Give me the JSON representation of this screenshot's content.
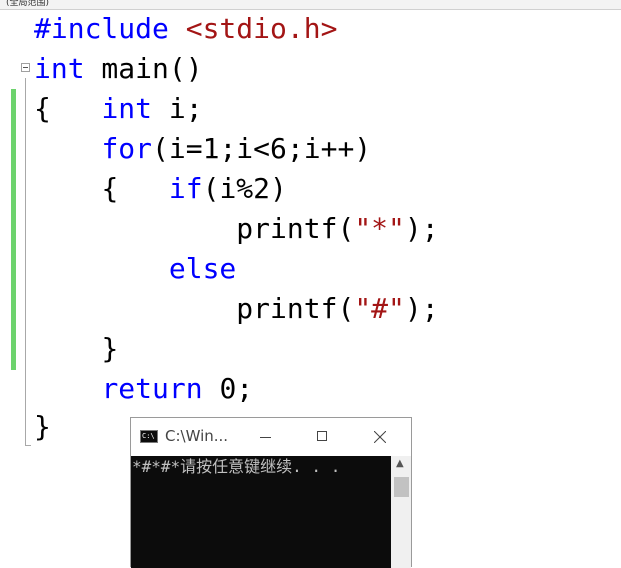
{
  "top_strip": {
    "text": "(全局范围)"
  },
  "code": {
    "line1": {
      "directive": "#include",
      "space": " ",
      "header": "<stdio.h>"
    },
    "line2": {
      "kw": "int",
      "rest": " main()"
    },
    "line3": {
      "brace": "{",
      "indent": "   ",
      "kw": "int",
      "rest": " i;"
    },
    "line4": {
      "indent": "    ",
      "kw": "for",
      "rest": "(i=1;i<6;i++)"
    },
    "line5": {
      "indent": "    ",
      "brace": "{",
      "gap": "   ",
      "kw": "if",
      "rest": "(i%2)"
    },
    "line6": {
      "indent": "            ",
      "fn": "printf(",
      "str": "\"*\"",
      "end": ");"
    },
    "line7": {
      "indent": "        ",
      "kw": "else"
    },
    "line8": {
      "indent": "            ",
      "fn": "printf(",
      "str": "\"#\"",
      "end": ");"
    },
    "line9": {
      "indent": "    ",
      "brace": "}"
    },
    "line10": {
      "indent": "    ",
      "kw": "return",
      "rest": " 0;"
    },
    "line11": {
      "brace": "}"
    }
  },
  "console": {
    "title": "C:\\Win...",
    "icon_label": "C:\\",
    "output": "*#*#*请按任意键继续. . .",
    "scroll_up": "▲"
  },
  "colors": {
    "keyword": "#0000ff",
    "string": "#a31515",
    "change_bar": "#6dd36d",
    "console_bg": "#0c0c0c"
  }
}
